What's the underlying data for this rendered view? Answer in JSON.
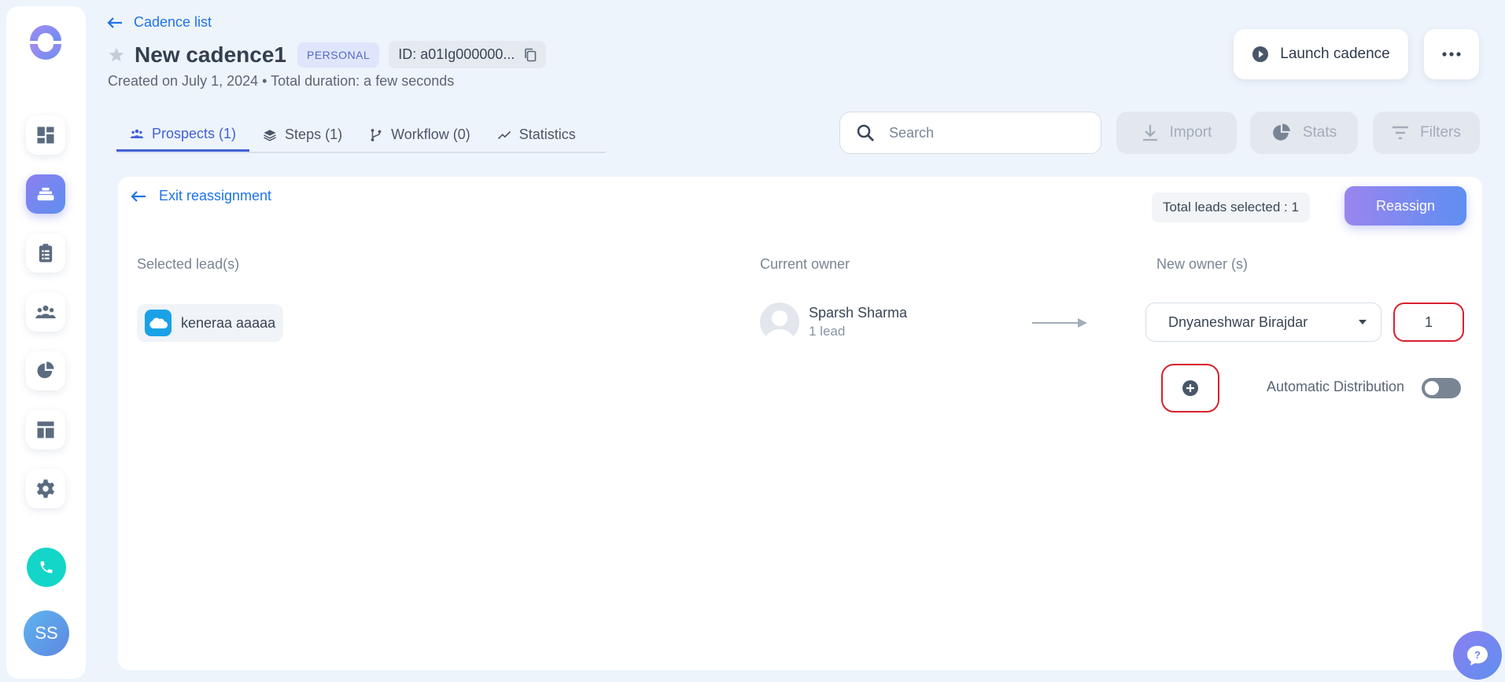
{
  "header": {
    "back_label": "Cadence list",
    "title": "New cadence1",
    "badge": "PERSONAL",
    "id_text": "ID: a01Ig000000...",
    "meta": "Created on July 1, 2024 • Total duration: a few seconds",
    "launch_label": "Launch cadence"
  },
  "tabs": [
    {
      "label": "Prospects (1)",
      "icon": "users-icon"
    },
    {
      "label": "Steps (1)",
      "icon": "layers-icon"
    },
    {
      "label": "Workflow (0)",
      "icon": "branch-icon"
    },
    {
      "label": "Statistics",
      "icon": "trend-icon"
    }
  ],
  "toolbar": {
    "search_placeholder": "Search",
    "import_label": "Import",
    "stats_label": "Stats",
    "filters_label": "Filters"
  },
  "reassign": {
    "exit_label": "Exit reassignment",
    "total_label": "Total leads selected : 1",
    "reassign_label": "Reassign",
    "col_selected": "Selected lead(s)",
    "col_current": "Current owner",
    "col_new": "New owner (s)",
    "lead_name": "keneraa aaaaa",
    "current_owner_name": "Sparsh Sharma",
    "current_owner_sub": "1 lead",
    "new_owner": "Dnyaneshwar Birajdar",
    "quantity": "1",
    "auto_distribution_label": "Automatic Distribution",
    "auto_distribution_on": false
  },
  "user": {
    "initials": "SS"
  },
  "colors": {
    "primary": "#1e74e8",
    "accent_gradient_start": "#9a85ef",
    "accent_gradient_end": "#5f8ef2",
    "highlight_border": "#d8202e",
    "call_button": "#13d6c8"
  }
}
